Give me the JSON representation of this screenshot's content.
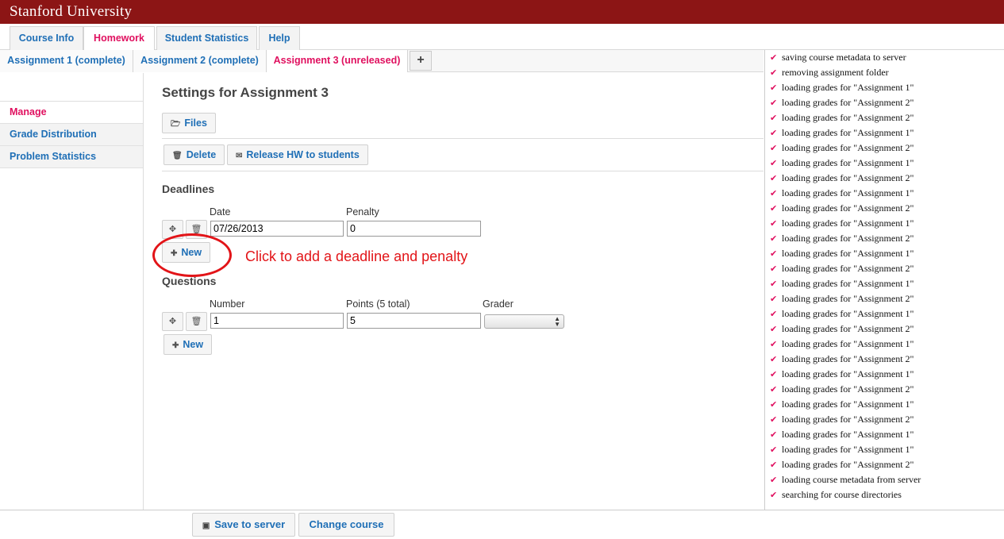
{
  "brand": "Stanford University",
  "nav_tabs": [
    "Course Info",
    "Homework",
    "Student Statistics",
    "Help"
  ],
  "assignment_tabs": [
    "Assignment 1 (complete)",
    "Assignment 2 (complete)",
    "Assignment 3 (unreleased)"
  ],
  "add_tab_label": "+",
  "sidebar": {
    "items": [
      "Manage",
      "Grade Distribution",
      "Problem Statistics"
    ]
  },
  "main": {
    "title": "Settings for Assignment 3",
    "files_label": "Files",
    "delete_label": "Delete",
    "release_label": "Release HW to students",
    "deadlines": {
      "title": "Deadlines",
      "col_date": "Date",
      "col_penalty": "Penalty",
      "date_value": "07/26/2013",
      "penalty_value": "0",
      "new_label": "New"
    },
    "questions": {
      "title": "Questions",
      "col_number": "Number",
      "col_points": "Points (5 total)",
      "col_grader": "Grader",
      "number_value": "1",
      "points_value": "5",
      "grader_value": "",
      "new_label": "New"
    }
  },
  "annotation": {
    "text": "Click to add a deadline and penalty",
    "color": "#e21418"
  },
  "log": [
    "saving course metadata to server",
    "removing assignment folder",
    "loading grades for \"Assignment 1\"",
    "loading grades for \"Assignment 2\"",
    "loading grades for \"Assignment 2\"",
    "loading grades for \"Assignment 1\"",
    "loading grades for \"Assignment 2\"",
    "loading grades for \"Assignment 1\"",
    "loading grades for \"Assignment 2\"",
    "loading grades for \"Assignment 1\"",
    "loading grades for \"Assignment 2\"",
    "loading grades for \"Assignment 1\"",
    "loading grades for \"Assignment 2\"",
    "loading grades for \"Assignment 1\"",
    "loading grades for \"Assignment 2\"",
    "loading grades for \"Assignment 1\"",
    "loading grades for \"Assignment 2\"",
    "loading grades for \"Assignment 1\"",
    "loading grades for \"Assignment 2\"",
    "loading grades for \"Assignment 1\"",
    "loading grades for \"Assignment 2\"",
    "loading grades for \"Assignment 1\"",
    "loading grades for \"Assignment 2\"",
    "loading grades for \"Assignment 1\"",
    "loading grades for \"Assignment 2\"",
    "loading grades for \"Assignment 1\"",
    "loading grades for \"Assignment 1\"",
    "loading grades for \"Assignment 2\"",
    "loading course metadata from server",
    "searching for course directories"
  ],
  "footer": {
    "save_label": "Save to server",
    "change_label": "Change course"
  },
  "colors": {
    "brand_red": "#8c1515",
    "active_pink": "#e0105f",
    "link_blue": "#1f6fb6"
  },
  "icons": [
    "folder-icon",
    "trash-icon",
    "envelope-icon",
    "move-icon",
    "plus-icon",
    "check-icon",
    "floppy-icon"
  ]
}
